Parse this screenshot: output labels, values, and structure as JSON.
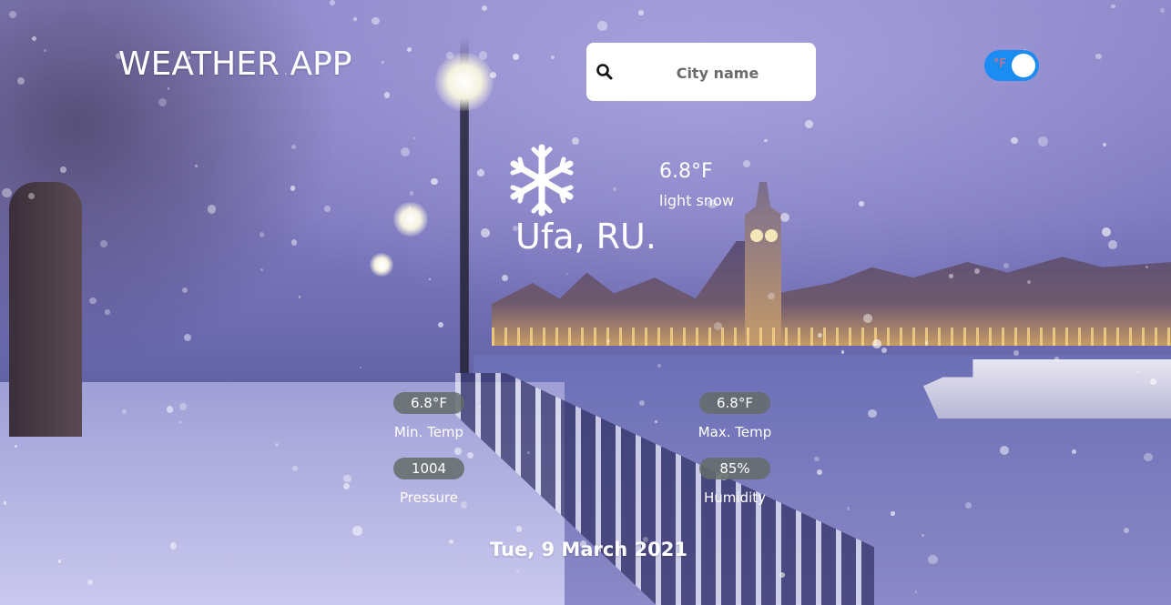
{
  "header": {
    "app_title": "WEATHER APP"
  },
  "search": {
    "placeholder": "City name",
    "value": "",
    "icon": "search-icon"
  },
  "unit_toggle": {
    "label": "°F",
    "active": true,
    "track_color": "#1b8df2",
    "label_color": "#ff6a6a"
  },
  "current": {
    "icon": "snowflake-icon",
    "temperature": "6.8°F",
    "description": "light snow",
    "location": "Ufa, RU."
  },
  "stats": {
    "min_temp": {
      "value": "6.8°F",
      "label": "Min. Temp"
    },
    "max_temp": {
      "value": "6.8°F",
      "label": "Max. Temp"
    },
    "pressure": {
      "value": "1004",
      "label": "Pressure"
    },
    "humidity": {
      "value": "85%",
      "label": "Humidity"
    }
  },
  "date": "Tue, 9 March 2021",
  "colors": {
    "pill_bg": "#646c69",
    "text": "#ffffff"
  }
}
